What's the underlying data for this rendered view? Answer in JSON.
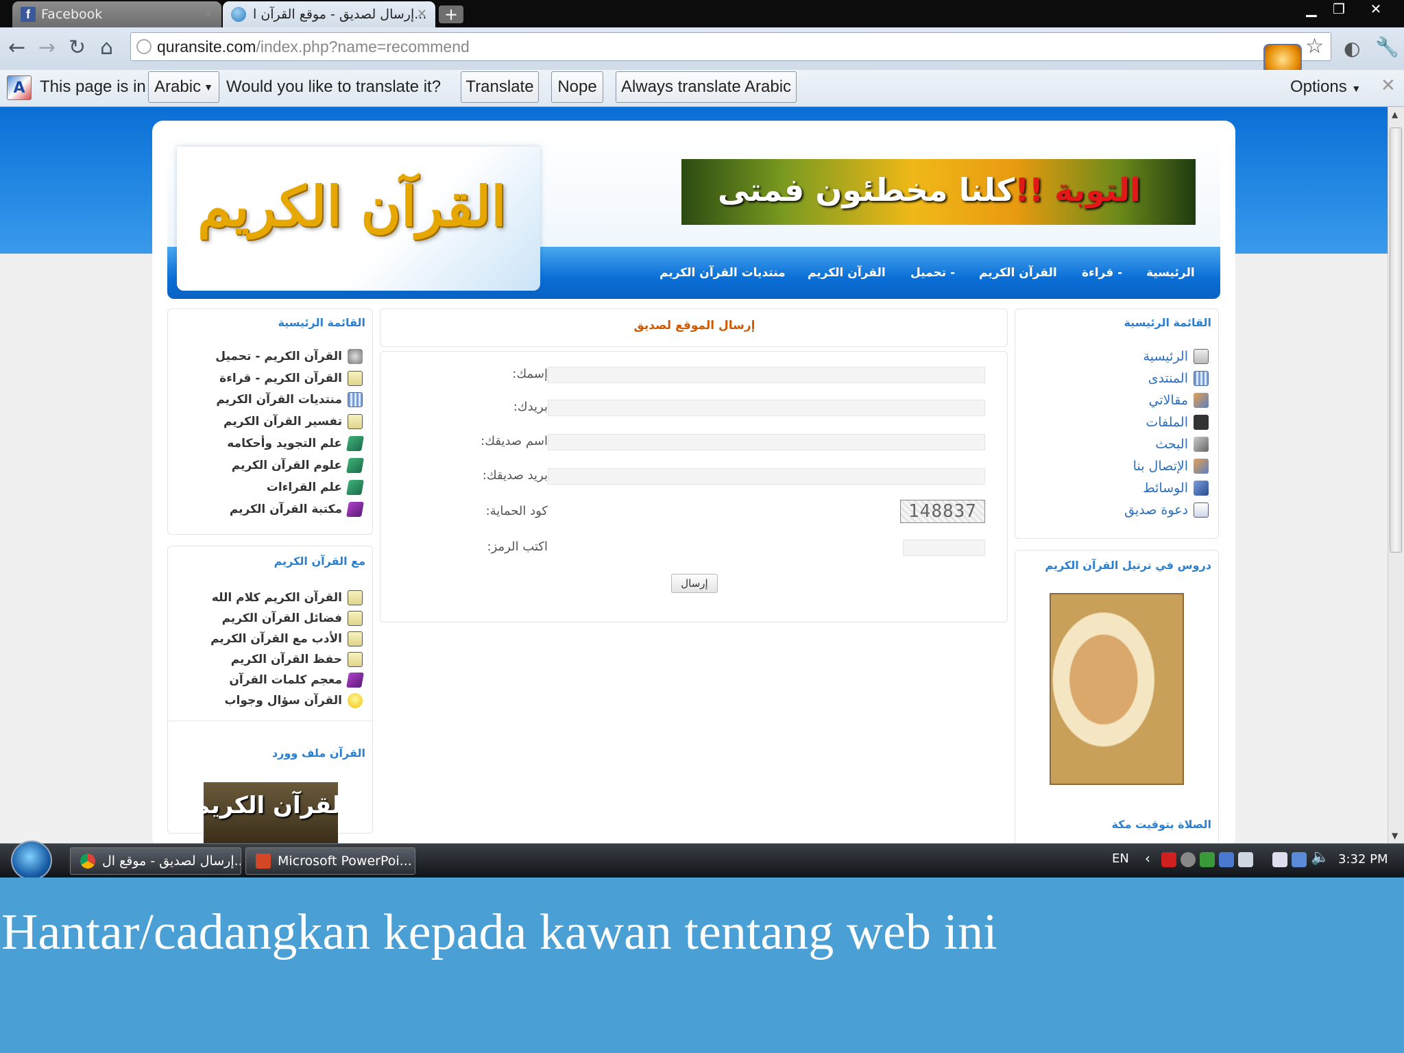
{
  "browser": {
    "tabs": [
      {
        "label": "Facebook",
        "icon": "facebook-icon"
      },
      {
        "label": "...إرسال لصديق - موقع القرآن ا",
        "icon": "globe-icon"
      }
    ],
    "url_host": "quransite.com",
    "url_path": "/index.php?name=recommend"
  },
  "translate_bar": {
    "prefix": "This page is in",
    "language": "Arabic",
    "question": "Would you like to translate it?",
    "translate": "Translate",
    "nope": "Nope",
    "always": "Always translate Arabic",
    "options": "Options"
  },
  "site": {
    "logo_text": "القرآن الكريم",
    "banner_text_main": "كلنا مخطئون فمتى ",
    "banner_text_red": "التوبة !!",
    "nav": [
      "الرئيسية",
      "- قراءة",
      "القرآن الكريم",
      "- تحميل",
      "القرآن الكريم",
      "منتديات القرآن الكريم"
    ]
  },
  "left_blocks": [
    {
      "title": "القائمة الرئيسية",
      "items": [
        {
          "label": "القرآن الكريم - تحميل",
          "icon": "speaker-icon"
        },
        {
          "label": "القرآن الكريم - قراءة",
          "icon": "book-icon"
        },
        {
          "label": "منتديات القرآن الكريم",
          "icon": "forum-icon"
        },
        {
          "label": "تفسير القرآن الكريم",
          "icon": "book-icon"
        },
        {
          "label": "علم التجويد وأحكامه",
          "icon": "green-book-icon"
        },
        {
          "label": "علوم القرآن الكريم",
          "icon": "green-book-icon"
        },
        {
          "label": "علم القراءات",
          "icon": "green-book-icon"
        },
        {
          "label": "مكتبة القرآن الكريم",
          "icon": "purple-book-icon"
        }
      ]
    },
    {
      "title": "مع القرآن الكريم",
      "items": [
        {
          "label": "القرآن الكريم كلام الله",
          "icon": "book-icon"
        },
        {
          "label": "فضائل القرآن الكريم",
          "icon": "book-icon"
        },
        {
          "label": "الأدب مع القرآن الكريم",
          "icon": "book-icon"
        },
        {
          "label": "حفظ القرآن الكريم",
          "icon": "book-icon"
        },
        {
          "label": "معجم كلمات القرآن",
          "icon": "purple-book-icon"
        },
        {
          "label": "القرآن سؤال وجواب",
          "icon": "bulb-icon"
        }
      ]
    },
    {
      "title": "القرآن ملف وورد",
      "image_text": "القرآن الكريم"
    }
  ],
  "center": {
    "title": "إرسال الموقع لصديق",
    "fields": [
      {
        "label": "إسمك:"
      },
      {
        "label": "بريدك:"
      },
      {
        "label": "اسم صديقك:"
      },
      {
        "label": "بريد صديقك:"
      }
    ],
    "captcha_label": "كود الحماية:",
    "captcha_code": "148837",
    "code_label": "اكتب الرمز:",
    "submit": "إرسال"
  },
  "right_blocks": [
    {
      "title": "القائمة الرئيسية",
      "items": [
        {
          "label": "الرئيسية",
          "icon": "house-icon"
        },
        {
          "label": "المنتدى",
          "icon": "forum-icon"
        },
        {
          "label": "مقالاتي",
          "icon": "articles-icon"
        },
        {
          "label": "الملفات",
          "icon": "files-icon"
        },
        {
          "label": "البحث",
          "icon": "search-icon"
        },
        {
          "label": "الإتصال بنا",
          "icon": "contact-icon"
        },
        {
          "label": "الوسائط",
          "icon": "media-icon"
        },
        {
          "label": "دعوة صديق",
          "icon": "invite-icon"
        }
      ]
    },
    {
      "title": "دروس في ترتيل القرآن الكريم"
    },
    {
      "title": "الصلاة بتوقيت مكة"
    }
  ],
  "taskbar": {
    "items": [
      "...إرسال لصديق - موقع ال",
      "Microsoft PowerPoi..."
    ],
    "lang": "EN",
    "time": "3:32 PM"
  },
  "caption": "Hantar/cadangkan kepada kawan tentang web ini"
}
